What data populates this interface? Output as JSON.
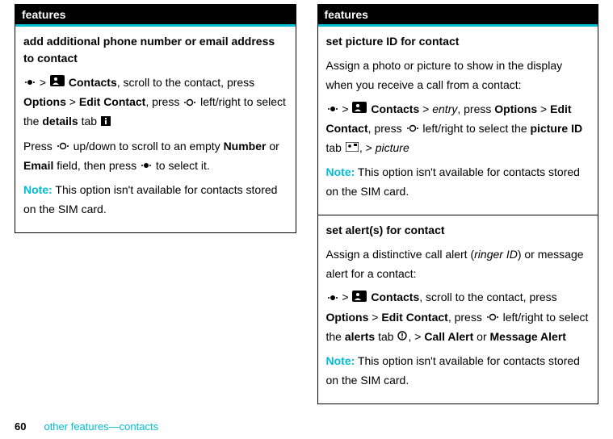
{
  "left": {
    "header": "features",
    "section1": {
      "title": "add additional phone number or email address to contact",
      "step1_a": " > ",
      "step1_b": " ",
      "step1_contacts": "Contacts",
      "step1_c": ", scroll to the contact, press ",
      "step1_options": "Options",
      "step1_d": " > ",
      "step1_edit": "Edit Contact",
      "step1_e": ", press ",
      "step1_f": " left/right to select the ",
      "step1_details": "details",
      "step1_g": " tab ",
      "step2_a": "Press ",
      "step2_b": " up/down to scroll to an empty ",
      "step2_number": "Number",
      "step2_c": " or ",
      "step2_email": "Email",
      "step2_d": " field, then press ",
      "step2_e": " to select it.",
      "note_label": "Note:",
      "note_text": " This option isn't available for contacts stored on the SIM card."
    }
  },
  "right": {
    "header": "features",
    "section1": {
      "title": "set picture ID for contact",
      "desc": "Assign a photo or picture to show in the display when you receive a call from a contact:",
      "step_a": " > ",
      "step_contacts": "Contacts",
      "step_b": " > ",
      "step_entry": "entry",
      "step_c": ", press ",
      "step_options": "Options",
      "step_d": " > ",
      "step_edit": "Edit Contact",
      "step_e": ", press ",
      "step_f": " left/right to select the ",
      "step_picid": "picture ID",
      "step_g": " tab ",
      "step_h": ", > ",
      "step_picture": "picture",
      "note_label": "Note:",
      "note_text": " This option isn't available for contacts stored on the SIM card."
    },
    "section2": {
      "title": "set alert(s) for contact",
      "desc_a": "Assign a distinctive call alert (",
      "desc_ringer": "ringer ID",
      "desc_b": ") or message alert for a contact:",
      "step_a": " > ",
      "step_contacts": "Contacts",
      "step_b": ", scroll to the contact, press ",
      "step_options": "Options",
      "step_c": " > ",
      "step_edit": "Edit Contact",
      "step_d": ", press ",
      "step_e": " left/right to select the ",
      "step_alerts": "alerts",
      "step_f": " tab ",
      "step_g": ", > ",
      "step_callalert": "Call Alert",
      "step_h": "  or  ",
      "step_msgalert": "Message Alert",
      "note_label": "Note:",
      "note_text": " This option isn't available for contacts stored on the SIM card."
    }
  },
  "footer": {
    "page": "60",
    "text": "other features—contacts"
  }
}
